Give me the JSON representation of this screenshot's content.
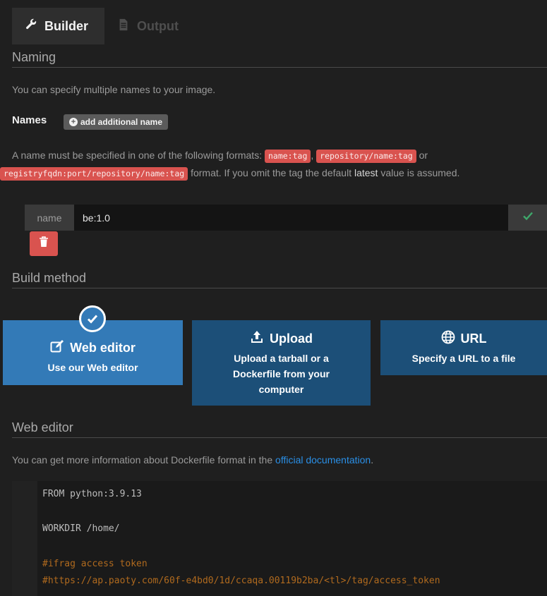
{
  "tabs": {
    "builder": "Builder",
    "output": "Output"
  },
  "naming": {
    "title": "Naming",
    "description": "You can specify multiple names to your image.",
    "names_label": "Names",
    "add_button": "add additional name",
    "format_text_1": "A name must be specified in one of the following formats:",
    "format_1": "name:tag",
    "format_sep": ",",
    "format_2": "repository/name:tag",
    "format_or": "or",
    "format_3": "registryfqdn:port/repository/name:tag",
    "format_text_2": "format. If you omit the tag the default",
    "format_latest": "latest",
    "format_text_3": "value is assumed.",
    "input_addon": "name",
    "input_value": "be:1.0"
  },
  "build_method": {
    "title": "Build method",
    "web_editor": {
      "title": "Web editor",
      "description": "Use our Web editor"
    },
    "upload": {
      "title": "Upload",
      "description_1": "Upload a tarball or a",
      "description_2": "Dockerfile from your",
      "description_3": "computer"
    },
    "url": {
      "title": "URL",
      "description": "Specify a URL to a file"
    }
  },
  "web_editor": {
    "title": "Web editor",
    "description": "You can get more information about Dockerfile format in the",
    "link": "official documentation",
    "link_suffix": ".",
    "code_lines": [
      {
        "text": "FROM python:3.9.13",
        "kind": "text"
      },
      {
        "text": "WORKDIR /home/",
        "kind": "text"
      },
      {
        "text": "#ifrag access token",
        "kind": "comment"
      },
      {
        "text": "#https://ap.paoty.com/60f-e4bd0/1d/ccaqa.00119b2ba/<tl>/tag/access_token",
        "kind": "comment"
      }
    ]
  },
  "colors": {
    "background": "#1f1f1f",
    "accent_blue": "#337ab7",
    "dark_blue": "#1c4f78",
    "danger": "#d9534f",
    "success": "#3fa86b",
    "link": "#2a8fe6"
  }
}
